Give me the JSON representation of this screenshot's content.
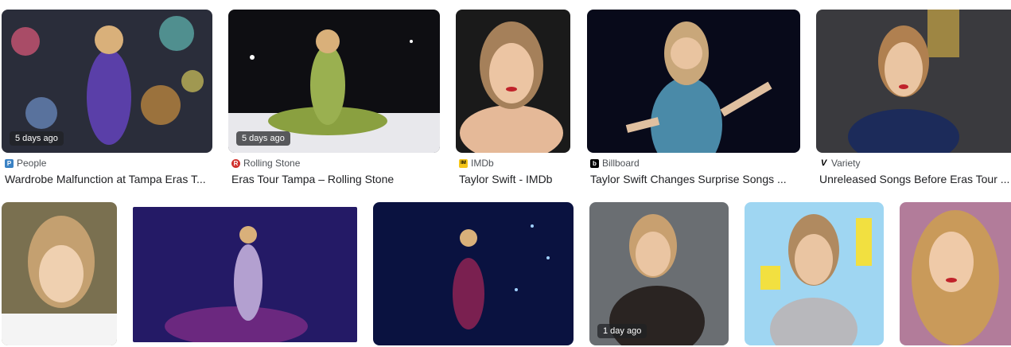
{
  "results": [
    {
      "source": "People",
      "title": "Wardrobe Malfunction at Tampa Eras T...",
      "age": "5 days ago",
      "favicon": "people-icon",
      "favicon_color": "#3b82c4"
    },
    {
      "source": "Rolling Stone",
      "title": "Eras Tour Tampa – Rolling Stone",
      "age": "5 days ago",
      "favicon": "rolling-stone-icon",
      "favicon_color": "#d0312d"
    },
    {
      "source": "IMDb",
      "title": "Taylor Swift - IMDb",
      "favicon": "imdb-icon",
      "favicon_color": "#f5c518"
    },
    {
      "source": "Billboard",
      "title": "Taylor Swift Changes Surprise Songs ...",
      "favicon": "billboard-icon",
      "favicon_color": "#000000"
    },
    {
      "source": "Variety",
      "title": "Unreleased Songs Before Eras Tour ...",
      "favicon": "variety-icon",
      "favicon_color": "#000000"
    },
    {
      "age": ""
    },
    {},
    {},
    {
      "age": "1 day ago"
    },
    {},
    {}
  ]
}
